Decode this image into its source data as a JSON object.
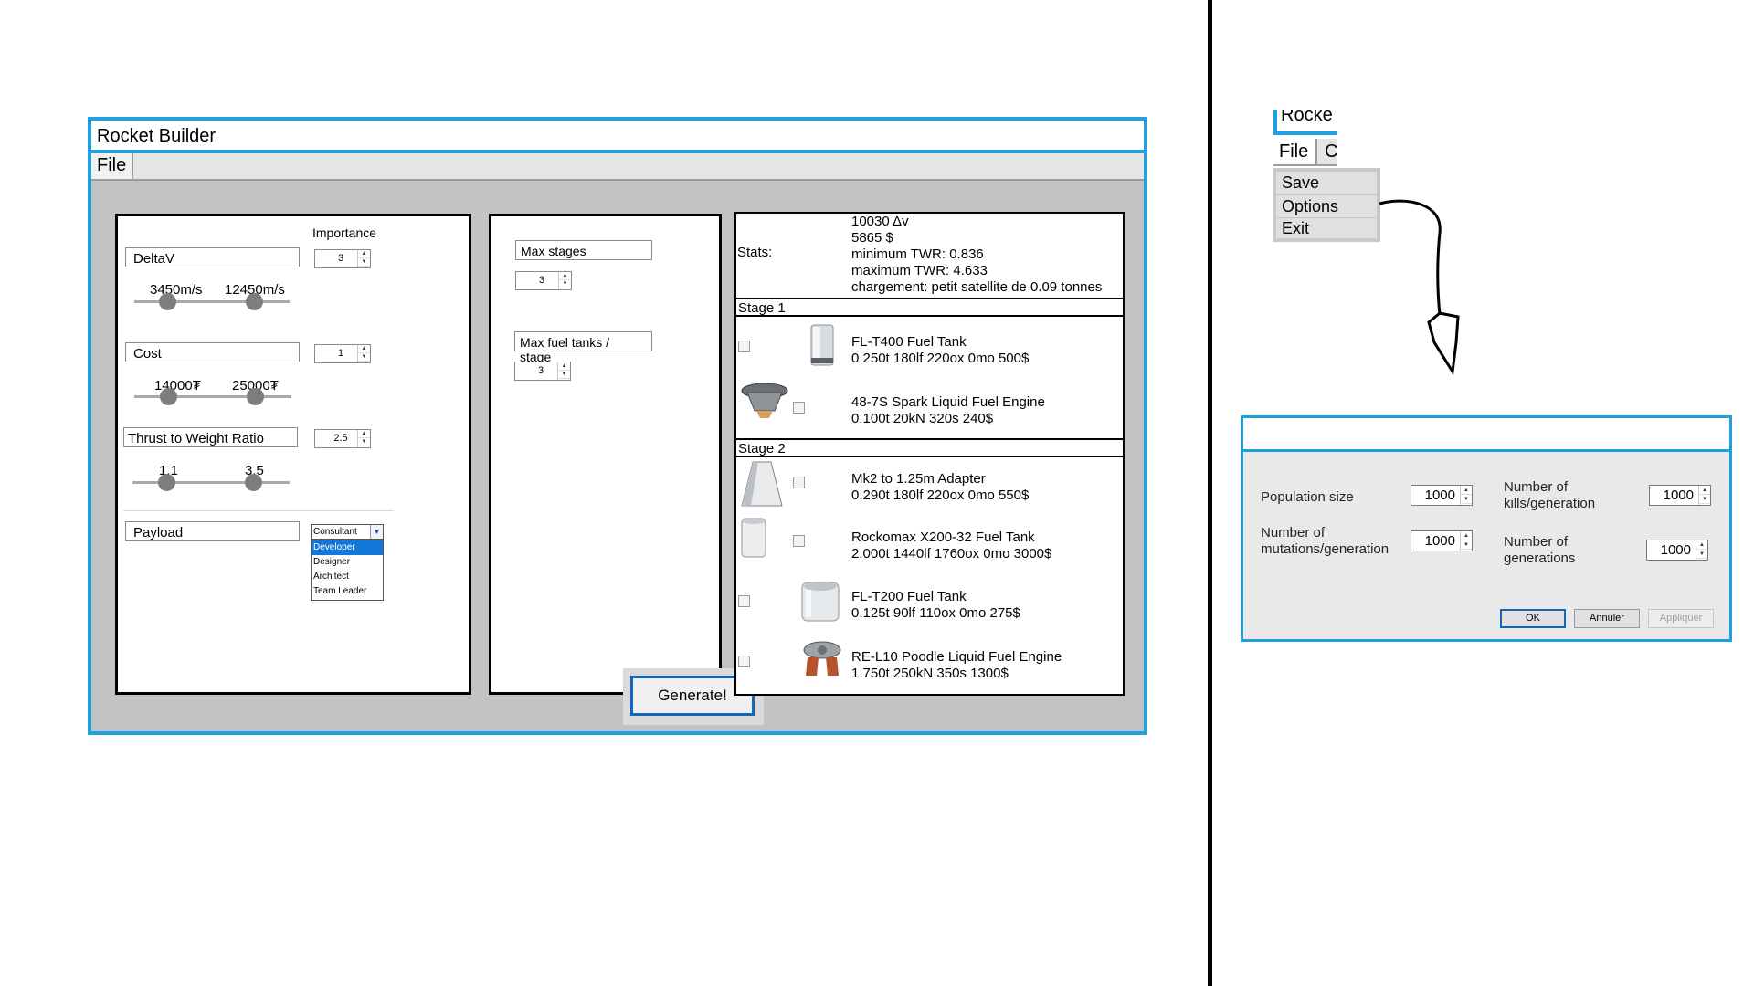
{
  "window": {
    "title": "Rocket Builder",
    "menu_file": "File"
  },
  "objectives": {
    "importance_header": "Importance",
    "deltav": {
      "label": "DeltaV",
      "importance": "3",
      "min": "3450m/s",
      "max": "12450m/s"
    },
    "cost": {
      "label": "Cost",
      "importance": "1",
      "min": "14000₮",
      "max": "25000₮"
    },
    "twr": {
      "label": "Thrust to Weight Ratio",
      "importance": "2.5",
      "min": "1.1",
      "max": "3.5"
    },
    "payload": {
      "label": "Payload",
      "dropdown_value": "Consultant",
      "options": [
        "Developer",
        "Designer",
        "Architect",
        "Team Leader"
      ],
      "selected_option": "Developer"
    }
  },
  "constraints": {
    "max_stages_label": "Max stages",
    "max_stages_value": "3",
    "max_fuel_tanks_label": "Max fuel tanks / stage",
    "max_fuel_tanks_value": "3",
    "generate_label": "Generate!"
  },
  "results": {
    "stats_label": "Stats:",
    "stats": [
      "10030 Δv",
      "5865 $",
      "minimum TWR: 0.836",
      "maximum TWR: 4.633",
      "chargement: petit satellite de 0.09 tonnes"
    ],
    "stages": [
      {
        "label": "Stage 1",
        "parts": [
          {
            "name": "FL-T400 Fuel Tank",
            "specs": "0.250t 180lf 220ox 0mo 500$",
            "icon": "fuel-tank-icon"
          },
          {
            "name": "48-7S Spark Liquid Fuel Engine",
            "specs": "0.100t 20kN 320s 240$",
            "icon": "engine-icon"
          }
        ]
      },
      {
        "label": "Stage 2",
        "parts": [
          {
            "name": "Mk2 to 1.25m Adapter",
            "specs": "0.290t 180lf 220ox 0mo 550$",
            "icon": "adapter-icon"
          },
          {
            "name": "Rockomax X200-32 Fuel Tank",
            "specs": "2.000t 1440lf 1760ox 0mo 3000$",
            "icon": "fuel-tank-icon"
          },
          {
            "name": "FL-T200 Fuel Tank",
            "specs": "0.125t 90lf 110ox 0mo 275$",
            "icon": "fuel-tank-icon"
          },
          {
            "name": "RE-L10 Poodle Liquid Fuel Engine",
            "specs": "1.750t 250kN 350s 1300$",
            "icon": "engine-icon"
          }
        ]
      }
    ]
  },
  "menu_mockup": {
    "title_fragment": "Rocke",
    "file_label": "File",
    "next_menu_fragment": "C",
    "items": [
      "Save Rocket",
      "Options",
      "Exit"
    ]
  },
  "options_dialog": {
    "population_size_label": "Population size",
    "population_size_value": "1000",
    "kills_label_line1": "Number of",
    "kills_label_line2": "kills/generation",
    "kills_value": "1000",
    "mutations_label_line1": "Number of",
    "mutations_label_line2": "mutations/generation",
    "mutations_value": "1000",
    "generations_label_line1": "Number of",
    "generations_label_line2": "generations",
    "generations_value": "1000",
    "ok_label": "OK",
    "cancel_label": "Annuler",
    "apply_label": "Appliquer"
  },
  "colors": {
    "accent": "#1ea0e1",
    "window_bg": "#c3c3c3",
    "selection": "#1177d8",
    "generate_border": "#1466b8"
  }
}
